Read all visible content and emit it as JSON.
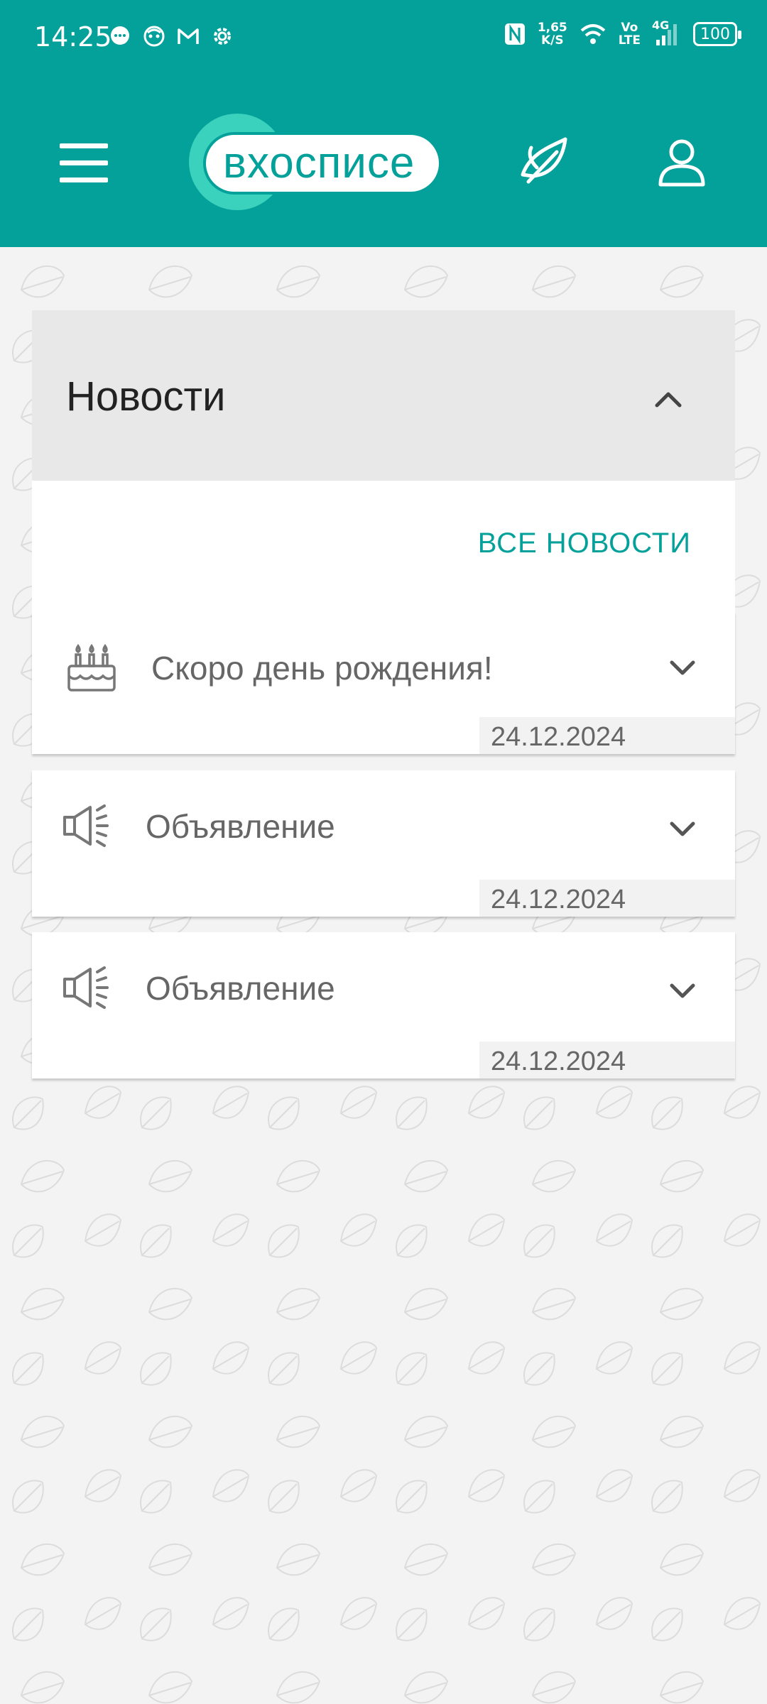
{
  "status_bar": {
    "time": "14:25",
    "speed_value": "1,65",
    "speed_unit": "K/S",
    "volte_top": "Vo",
    "volte_bottom": "LTE",
    "network": "4G",
    "battery": "100"
  },
  "header": {
    "logo_text": "вхосписе"
  },
  "news": {
    "title": "Новости",
    "all_news_label": "ВСЕ НОВОСТИ",
    "items": [
      {
        "icon": "birthday-cake-icon",
        "title": "Скоро день рождения!",
        "date": "24.12.2024"
      },
      {
        "icon": "megaphone-icon",
        "title": "Объявление",
        "date": "24.12.2024"
      },
      {
        "icon": "megaphone-icon",
        "title": "Объявление",
        "date": "24.12.2024"
      }
    ]
  },
  "colors": {
    "brand": "#04a09a",
    "logo_ring": "#3ad1bd",
    "background": "#f3f3f3"
  }
}
